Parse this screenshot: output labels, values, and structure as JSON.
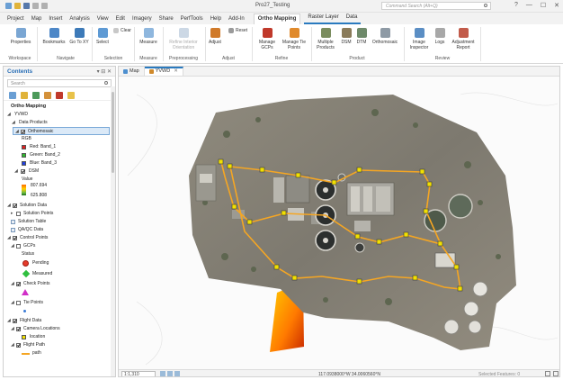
{
  "titlebar": {
    "project_title": "Pro27_Testing",
    "search_placeholder": "Command Search (Alt+Q)",
    "controls": [
      "?",
      "—",
      "☐",
      "✕"
    ]
  },
  "tabs": [
    {
      "label": "Project"
    },
    {
      "label": "Map"
    },
    {
      "label": "Insert"
    },
    {
      "label": "Analysis"
    },
    {
      "label": "View"
    },
    {
      "label": "Edit"
    },
    {
      "label": "Imagery"
    },
    {
      "label": "Share"
    },
    {
      "label": "PerfTools"
    },
    {
      "label": "Help"
    },
    {
      "label": "Add-In"
    },
    {
      "label": "Ortho Mapping"
    },
    {
      "label": "Raster Layer"
    },
    {
      "label": "Data"
    }
  ],
  "ribbon": {
    "buttons": {
      "properties": "Properties",
      "bookmarks": "Bookmarks",
      "goto_xy": "Go To XY",
      "select": "Select",
      "clear": "Clear",
      "measure": "Measure",
      "refine_interior": "Refine Interior Orientation",
      "adjust": "Adjust",
      "reset": "Reset",
      "manage_gcps": "Manage GCPs",
      "manage_tie_points": "Manage Tie Points",
      "multiple_products": "Multiple Products",
      "dsm": "DSM",
      "dtm": "DTM",
      "orthomosaic": "Orthomosaic",
      "image_inspector": "Image Inspector",
      "logs": "Logs",
      "adjustment_report": "Adjustment Report"
    },
    "groups": {
      "workspace": "Workspace",
      "navigate": "Navigate",
      "selection": "Selection",
      "measure": "Measure",
      "preprocessing": "Preprocessing",
      "adjust": "Adjust",
      "refine": "Refine",
      "product": "Product",
      "review": "Review"
    }
  },
  "contents": {
    "title": "Contents",
    "search_placeholder": "Search",
    "heading": "Ortho Mapping",
    "root": "YVWD",
    "data_products": "Data Products",
    "orthomosaic": "Orthomosaic",
    "rgb": "RGB",
    "bands": {
      "red": "Red:  Band_1",
      "green": "Green: Band_2",
      "blue": "Blue:  Band_3"
    },
    "dsm": "DSM",
    "value": "Value",
    "dsm_max": "807.694",
    "dsm_min": "625.808",
    "solution_data": "Solution Data",
    "solution_points": "Solution Points",
    "solution_table": "Solution Table",
    "qa_qc": "QA/QC Data",
    "control_points": "Control Points",
    "gcps": "GCPs",
    "status": "Status",
    "pending": "Pending",
    "measured": "Measured",
    "check_points": "Check Points",
    "tie_points": "Tie Points",
    "flight_data": "Flight Data",
    "camera_locations": "Camera Locations",
    "location": "location",
    "flight_path": "Flight Path",
    "path": "path"
  },
  "map": {
    "tabs": [
      "Map",
      "YVWD"
    ],
    "scale": "1:1,310",
    "coordinates": "117.0938000°W 34.0060560°N",
    "selected_features": "Selected Features: 0",
    "accent": "#f2a31c",
    "path_color": "#f5a623"
  }
}
